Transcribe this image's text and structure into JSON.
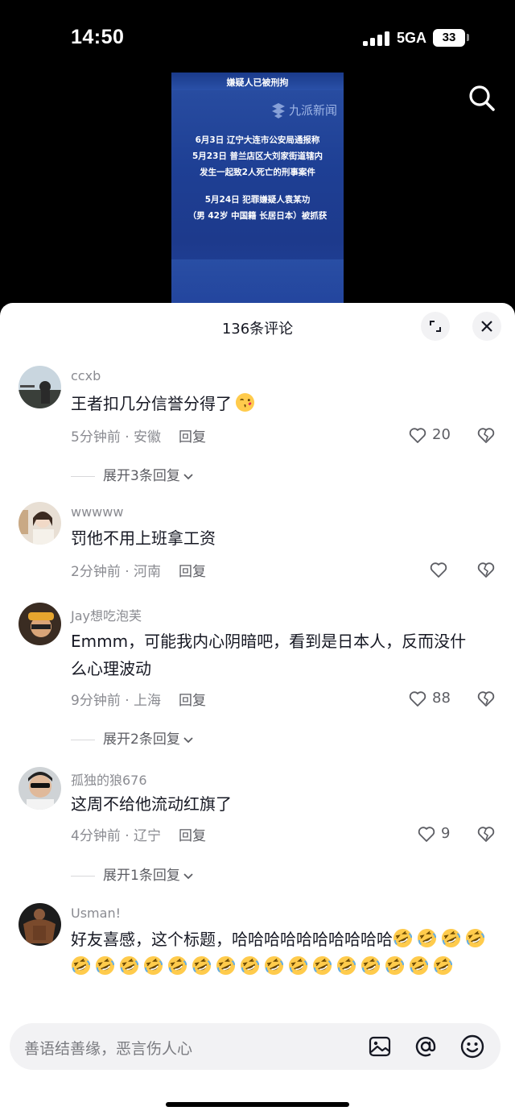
{
  "status_bar": {
    "time": "14:50",
    "network": "5GA",
    "battery": "33"
  },
  "video": {
    "title": "嫌疑人已被刑拘",
    "logo": "九派新闻",
    "lines": [
      "6月3日 辽宁大连市公安局通报称",
      "5月23日 普兰店区大刘家街道辖内",
      "发生一起致2人死亡的刑事案件",
      "",
      "5月24日 犯罪嫌疑人袁某功",
      "（男 42岁 中国籍 长居日本）被抓获"
    ]
  },
  "comments_sheet": {
    "title": "136条评论",
    "comments": [
      {
        "user": "ccxb",
        "text": "王者扣几分信誉分得了",
        "has_emoji": true,
        "time": "5分钟前 · 安徽",
        "reply": "回复",
        "likes": "20",
        "expand": "展开3条回复"
      },
      {
        "user": "wwwww",
        "text": "罚他不用上班拿工资",
        "time": "2分钟前 · 河南",
        "reply": "回复",
        "likes": ""
      },
      {
        "user": "Jay想吃泡芙",
        "text_lines": [
          "Emmm，可能我内心阴暗吧，看到是日本人，反而没什",
          "么心理波动"
        ],
        "time": "9分钟前 · 上海",
        "reply": "回复",
        "likes": "88",
        "expand": "展开2条回复"
      },
      {
        "user": "孤独的狼676",
        "text": "这周不给他流动红旗了",
        "time": "4分钟前 · 辽宁",
        "reply": "回复",
        "likes": "9",
        "expand": "展开1条回复"
      },
      {
        "user": "Usman!",
        "text": "好友喜感，这个标题，哈哈哈哈哈哈哈哈哈哈"
      }
    ]
  },
  "input": {
    "placeholder": "善语结善缘，恶言伤人心"
  },
  "icons": {
    "search": "search-icon",
    "expand": "expand-icon",
    "close": "close-icon",
    "like": "heart-icon",
    "dislike": "broken-heart-icon",
    "image": "image-icon",
    "mention": "at-icon",
    "emoji": "emoji-icon"
  }
}
